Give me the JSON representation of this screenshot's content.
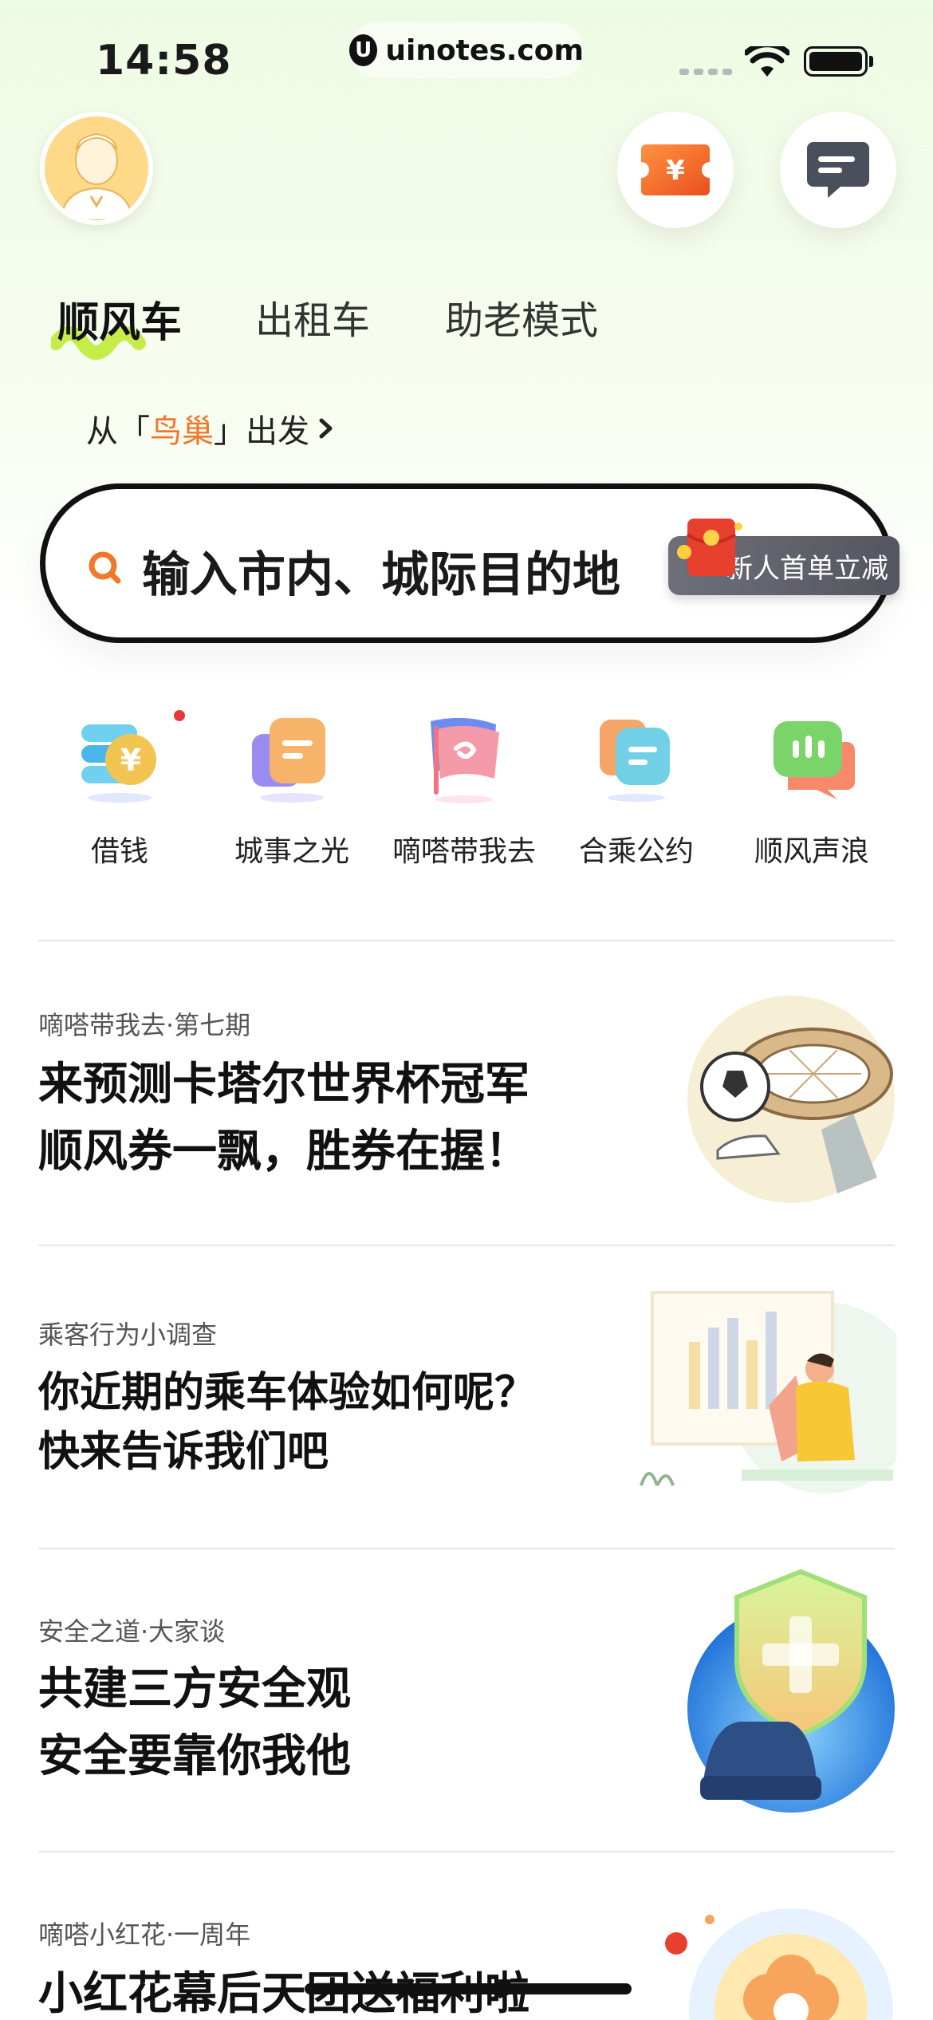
{
  "status": {
    "time": "14:58",
    "url": "uinotes.com",
    "url_logo": "U"
  },
  "header": {
    "avatar": "avatar",
    "coupon_icon": "yen-ticket-icon",
    "message_icon": "chat-icon"
  },
  "tabs": [
    {
      "label": "顺风车",
      "active": true
    },
    {
      "label": "出租车",
      "active": false
    },
    {
      "label": "助老模式",
      "active": false
    }
  ],
  "departure": {
    "prefix": "从「",
    "place": "鸟巢",
    "suffix": "」出发"
  },
  "search": {
    "placeholder": "输入市内、城际目的地",
    "promo": "新人首单立减"
  },
  "quick_entries": [
    {
      "label": "借钱",
      "icon": "yen-coin-stack-icon",
      "has_dot": true
    },
    {
      "label": "城事之光",
      "icon": "document-card-icon",
      "has_dot": false
    },
    {
      "label": "嘀嗒带我去",
      "icon": "flag-icon",
      "has_dot": false
    },
    {
      "label": "合乘公约",
      "icon": "agreement-card-icon",
      "has_dot": false
    },
    {
      "label": "顺风声浪",
      "icon": "voice-chat-icon",
      "has_dot": false
    }
  ],
  "cards": [
    {
      "tag": "嘀嗒带我去·第七期",
      "title_line1": "来预测卡塔尔世界杯冠军",
      "title_line2": "顺风券一飘，胜券在握！",
      "image": "world-cup-stadium-illustration"
    },
    {
      "tag": "乘客行为小调查",
      "title_line1": "你近期的乘车体验如何呢？",
      "title_line2": "快来告诉我们吧",
      "image": "survey-presenter-illustration"
    },
    {
      "tag": "安全之道·大家谈",
      "title_line1": "共建三方安全观",
      "title_line2": "安全要靠你我他",
      "image": "safety-shield-car-illustration"
    },
    {
      "tag": "嘀嗒小红花·一周年",
      "title_line1": "小红花幕后天团送福利啦",
      "title_line2": "",
      "image": "red-flower-illustration"
    }
  ],
  "colors": {
    "accent": "#f0782a",
    "coupon": "#f06a2a",
    "tab_highlight": "#c6ec4a",
    "promo_bg": "#5e5e68"
  }
}
